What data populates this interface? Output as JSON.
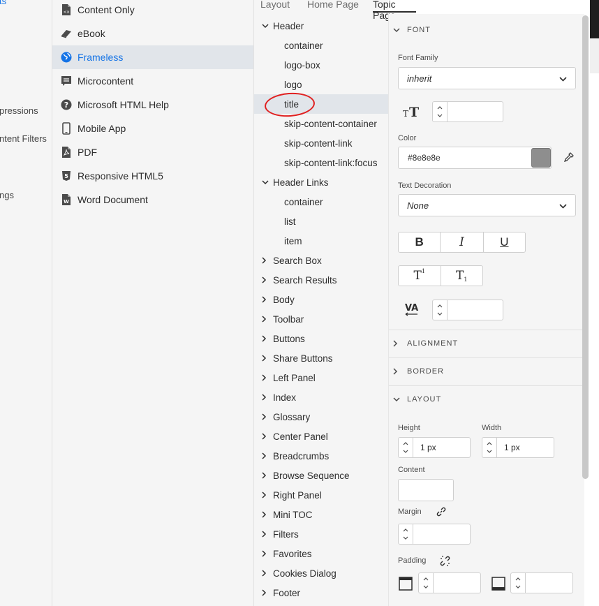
{
  "left_pane": {
    "items": [
      "ts",
      "pressions",
      "ntent Filters",
      "ngs"
    ]
  },
  "outputs": {
    "items": [
      {
        "label": "Content Only",
        "icon": "content-only-icon"
      },
      {
        "label": "eBook",
        "icon": "ebook-icon"
      },
      {
        "label": "Frameless",
        "icon": "globe-icon",
        "selected": true
      },
      {
        "label": "Microcontent",
        "icon": "microcontent-icon"
      },
      {
        "label": "Microsoft HTML Help",
        "icon": "help-icon"
      },
      {
        "label": "Mobile App",
        "icon": "mobile-icon"
      },
      {
        "label": "PDF",
        "icon": "pdf-icon"
      },
      {
        "label": "Responsive HTML5",
        "icon": "html5-icon"
      },
      {
        "label": "Word Document",
        "icon": "word-icon"
      }
    ]
  },
  "tabs": [
    "Layout",
    "Home Page",
    "Topic Page"
  ],
  "tree": {
    "header": {
      "label": "Header",
      "children": [
        "container",
        "logo-box",
        "logo",
        "title",
        "skip-content-container",
        "skip-content-link",
        "skip-content-link:focus"
      ]
    },
    "header_links": {
      "label": "Header Links",
      "children": [
        "container",
        "list",
        "item"
      ]
    },
    "collapsed": [
      "Search Box",
      "Search Results",
      "Body",
      "Toolbar",
      "Buttons",
      "Share Buttons",
      "Left Panel",
      "Index",
      "Glossary",
      "Center Panel",
      "Breadcrumbs",
      "Browse Sequence",
      "Right Panel",
      "Mini TOC",
      "Filters",
      "Favorites",
      "Cookies Dialog",
      "Footer"
    ]
  },
  "props": {
    "font": {
      "heading": "FONT",
      "font_family_label": "Font Family",
      "font_family_value": "inherit",
      "font_size_value": "",
      "color_label": "Color",
      "color_value": "#8e8e8e",
      "text_decoration_label": "Text Decoration",
      "text_decoration_value": "None",
      "bold": "B",
      "italic": "I",
      "underline": "U",
      "superscript": "T",
      "subscript": "T",
      "letter_spacing_value": ""
    },
    "alignment_heading": "ALIGNMENT",
    "border_heading": "BORDER",
    "layout": {
      "heading": "LAYOUT",
      "height_label": "Height",
      "height_value": "1 px",
      "width_label": "Width",
      "width_value": "1 px",
      "content_label": "Content",
      "margin_label": "Margin",
      "padding_label": "Padding"
    }
  },
  "colors": {
    "accent": "#1473e6",
    "swatch": "#8e8e8e",
    "annotation": "#e02020"
  }
}
